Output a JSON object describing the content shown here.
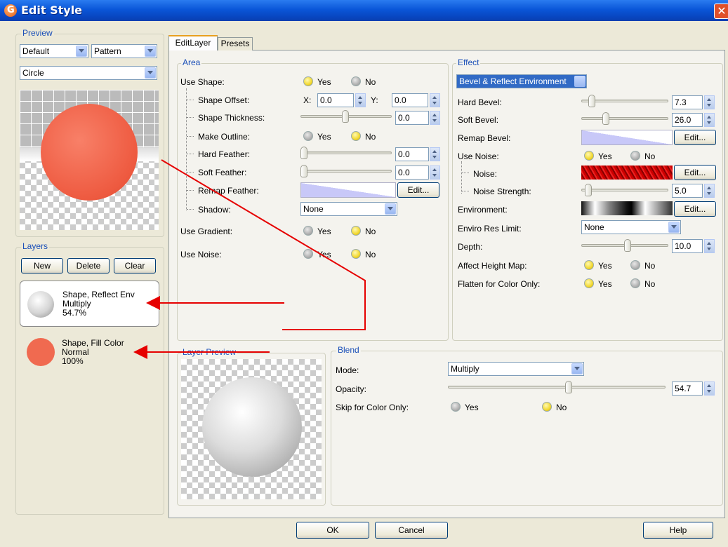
{
  "window": {
    "title": "Edit Style",
    "close_glyph": "✕"
  },
  "preview": {
    "legend": "Preview",
    "select1": "Default",
    "select2": "Pattern",
    "select3": "Circle",
    "shape_color": "#f06a50"
  },
  "layers": {
    "legend": "Layers",
    "new_label": "New",
    "delete_label": "Delete",
    "clear_label": "Clear",
    "items": [
      {
        "name": "Shape, Reflect Env",
        "mode": "Multiply",
        "opacity": "54.7%"
      },
      {
        "name": "Shape, Fill Color",
        "mode": "Normal",
        "opacity": "100%"
      }
    ]
  },
  "tabs": {
    "edit_layer": "EditLayer",
    "presets": "Presets"
  },
  "area": {
    "legend": "Area",
    "use_shape": "Use Shape:",
    "shape_offset": "Shape Offset:",
    "x_label": "X:",
    "x_value": "0.0",
    "y_label": "Y:",
    "y_value": "0.0",
    "shape_thickness": "Shape Thickness:",
    "shape_thickness_value": "0.0",
    "make_outline": "Make Outline:",
    "hard_feather": "Hard Feather:",
    "hard_feather_value": "0.0",
    "soft_feather": "Soft Feather:",
    "soft_feather_value": "0.0",
    "remap_feather": "Remap Feather:",
    "shadow": "Shadow:",
    "shadow_value": "None",
    "use_gradient": "Use Gradient:",
    "use_noise": "Use Noise:"
  },
  "common": {
    "yes": "Yes",
    "no": "No",
    "edit": "Edit..."
  },
  "effect": {
    "legend": "Effect",
    "type": "Bevel & Reflect Environment",
    "hard_bevel": "Hard Bevel:",
    "hard_bevel_value": "7.3",
    "soft_bevel": "Soft Bevel:",
    "soft_bevel_value": "26.0",
    "remap_bevel": "Remap Bevel:",
    "use_noise": "Use Noise:",
    "noise": "Noise:",
    "noise_strength": "Noise Strength:",
    "noise_strength_value": "5.0",
    "environment": "Environment:",
    "enviro_res_limit": "Enviro Res Limit:",
    "enviro_res_value": "None",
    "depth": "Depth:",
    "depth_value": "10.0",
    "affect_height_map": "Affect Height Map:",
    "flatten_for_color_only": "Flatten for Color Only:"
  },
  "layer_preview": {
    "legend": "Layer Preview"
  },
  "blend": {
    "legend": "Blend",
    "mode": "Mode:",
    "mode_value": "Multiply",
    "opacity": "Opacity:",
    "opacity_value": "54.7",
    "skip_for_color_only": "Skip for Color Only:"
  },
  "footer": {
    "ok": "OK",
    "cancel": "Cancel",
    "help": "Help"
  }
}
